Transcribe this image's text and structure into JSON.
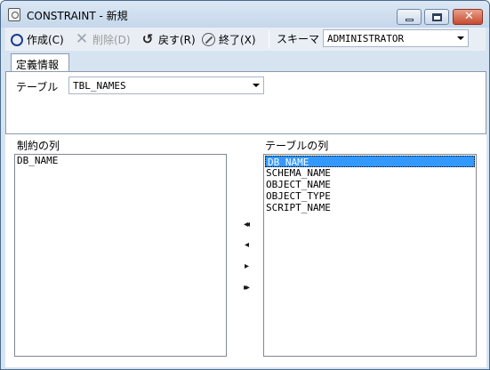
{
  "window": {
    "title": "CONSTRAINT - 新規"
  },
  "toolbar": {
    "create_label": "作成(C)",
    "delete_label": "削除(D)",
    "back_label": "戻す(R)",
    "exit_label": "終了(X)",
    "schema_label": "スキーマ",
    "schema_value": "ADMINISTRATOR"
  },
  "tabs": [
    {
      "label": "定義情報"
    }
  ],
  "definition": {
    "table_label": "テーブル",
    "table_value": "TBL_NAMES"
  },
  "constraint_columns": {
    "label": "制約の列",
    "items": [
      "DB_NAME"
    ]
  },
  "table_columns": {
    "label": "テーブルの列",
    "items": [
      "DB_NAME",
      "SCHEMA_NAME",
      "OBJECT_NAME",
      "OBJECT_TYPE",
      "SCRIPT_NAME"
    ],
    "selected_index": 0
  },
  "move_buttons": {
    "add_all": "◂◂",
    "add_one": "◂",
    "remove_one": "▸",
    "remove_all": "▸▸"
  },
  "colors": {
    "selection": "#3399ff",
    "title_gradient_top": "#dbe7f4",
    "toolbar_icon_blue": "#1c3d8a"
  },
  "icons": {
    "app": "app-icon",
    "create": "circle-icon",
    "delete": "x-icon",
    "back": "undo-icon",
    "exit": "stop-icon"
  }
}
